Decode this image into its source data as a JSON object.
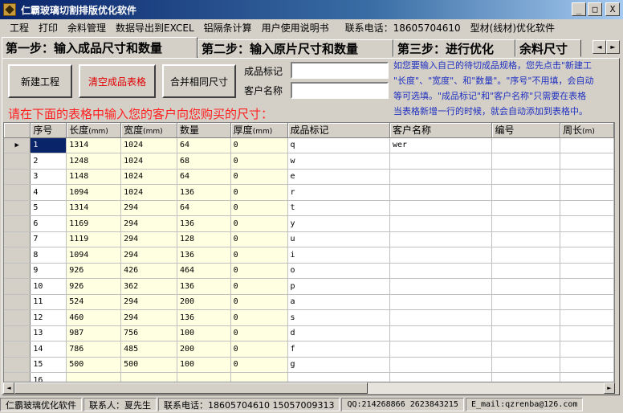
{
  "window": {
    "title": "仁霸玻璃切割排版优化软件",
    "minimize": "_",
    "maximize": "□",
    "close": "X"
  },
  "menu": [
    "工程",
    "打印",
    "余料管理",
    "数据导出到EXCEL",
    "铝隔条计算",
    "用户使用说明书",
    "联系电话：18605704610",
    "型材(线材)优化软件"
  ],
  "tabs": [
    {
      "label": "第一步：输入成品尺寸和数量",
      "active": true
    },
    {
      "label": "第二步：输入原片尺寸和数量",
      "active": false
    },
    {
      "label": "第三步：进行优化",
      "active": false
    },
    {
      "label": "余料尺寸",
      "active": false
    }
  ],
  "tab_scroll": {
    "left": "◄",
    "right": "►"
  },
  "buttons": {
    "new_project": "新建工程",
    "clear_table": "清空成品表格",
    "merge_sizes": "合并相同尺寸"
  },
  "fields": {
    "product_mark_label": "成品标记",
    "customer_name_label": "客户名称",
    "product_mark_value": "",
    "customer_name_value": ""
  },
  "info_lines": [
    "如您要输入自己的待切成品规格，您先点击\"新建工",
    "\"长度\"、\"宽度\"、和\"数量\"。\"序号\"不用填，会自动",
    "等可选填。\"成品标记\"和\"客户名称\"只需要在表格",
    "当表格新增一行的时候，就会自动添加到表格中。"
  ],
  "instruction": "请在下面的表格中输入您的客户向您购买的尺寸：",
  "table": {
    "headers": [
      {
        "text": "序号",
        "unit": ""
      },
      {
        "text": "长度",
        "unit": "(mm)"
      },
      {
        "text": "宽度",
        "unit": "(mm)"
      },
      {
        "text": "数量",
        "unit": ""
      },
      {
        "text": "厚度",
        "unit": "(mm)"
      },
      {
        "text": "成品标记",
        "unit": ""
      },
      {
        "text": "客户名称",
        "unit": ""
      },
      {
        "text": "编号",
        "unit": ""
      },
      {
        "text": "周长",
        "unit": "(m)"
      }
    ],
    "current_row_marker": "▶",
    "rows": [
      [
        "1",
        "1314",
        "1024",
        "64",
        "0",
        "q",
        "wer",
        "",
        ""
      ],
      [
        "2",
        "1248",
        "1024",
        "68",
        "0",
        "w",
        "",
        "",
        ""
      ],
      [
        "3",
        "1148",
        "1024",
        "64",
        "0",
        "e",
        "",
        "",
        ""
      ],
      [
        "4",
        "1094",
        "1024",
        "136",
        "0",
        "r",
        "",
        "",
        ""
      ],
      [
        "5",
        "1314",
        "294",
        "64",
        "0",
        "t",
        "",
        "",
        ""
      ],
      [
        "6",
        "1169",
        "294",
        "136",
        "0",
        "y",
        "",
        "",
        ""
      ],
      [
        "7",
        "1119",
        "294",
        "128",
        "0",
        "u",
        "",
        "",
        ""
      ],
      [
        "8",
        "1094",
        "294",
        "136",
        "0",
        "i",
        "",
        "",
        ""
      ],
      [
        "9",
        "926",
        "426",
        "464",
        "0",
        "o",
        "",
        "",
        ""
      ],
      [
        "10",
        "926",
        "362",
        "136",
        "0",
        "p",
        "",
        "",
        ""
      ],
      [
        "11",
        "524",
        "294",
        "200",
        "0",
        "a",
        "",
        "",
        ""
      ],
      [
        "12",
        "460",
        "294",
        "136",
        "0",
        "s",
        "",
        "",
        ""
      ],
      [
        "13",
        "987",
        "756",
        "100",
        "0",
        "d",
        "",
        "",
        ""
      ],
      [
        "14",
        "786",
        "485",
        "200",
        "0",
        "f",
        "",
        "",
        ""
      ],
      [
        "15",
        "500",
        "500",
        "100",
        "0",
        "g",
        "",
        "",
        ""
      ],
      [
        "16",
        "",
        "",
        "",
        "",
        "",
        "",
        "",
        ""
      ]
    ]
  },
  "scrollbar": {
    "left": "◄",
    "right": "►"
  },
  "status": {
    "app": "仁霸玻璃优化软件",
    "contact": "联系人：夏先生",
    "phones": "联系电话：18605704610  15057009313",
    "qq": "QQ:214268866 2623843215",
    "email": "E_mail:qzrenba@126.com"
  },
  "colors": {
    "titlebar_start": "#0a246a",
    "accent_red": "#e00000",
    "info_blue": "#2030c0",
    "cream": "#ffffe1",
    "selection": "#0a246a"
  }
}
